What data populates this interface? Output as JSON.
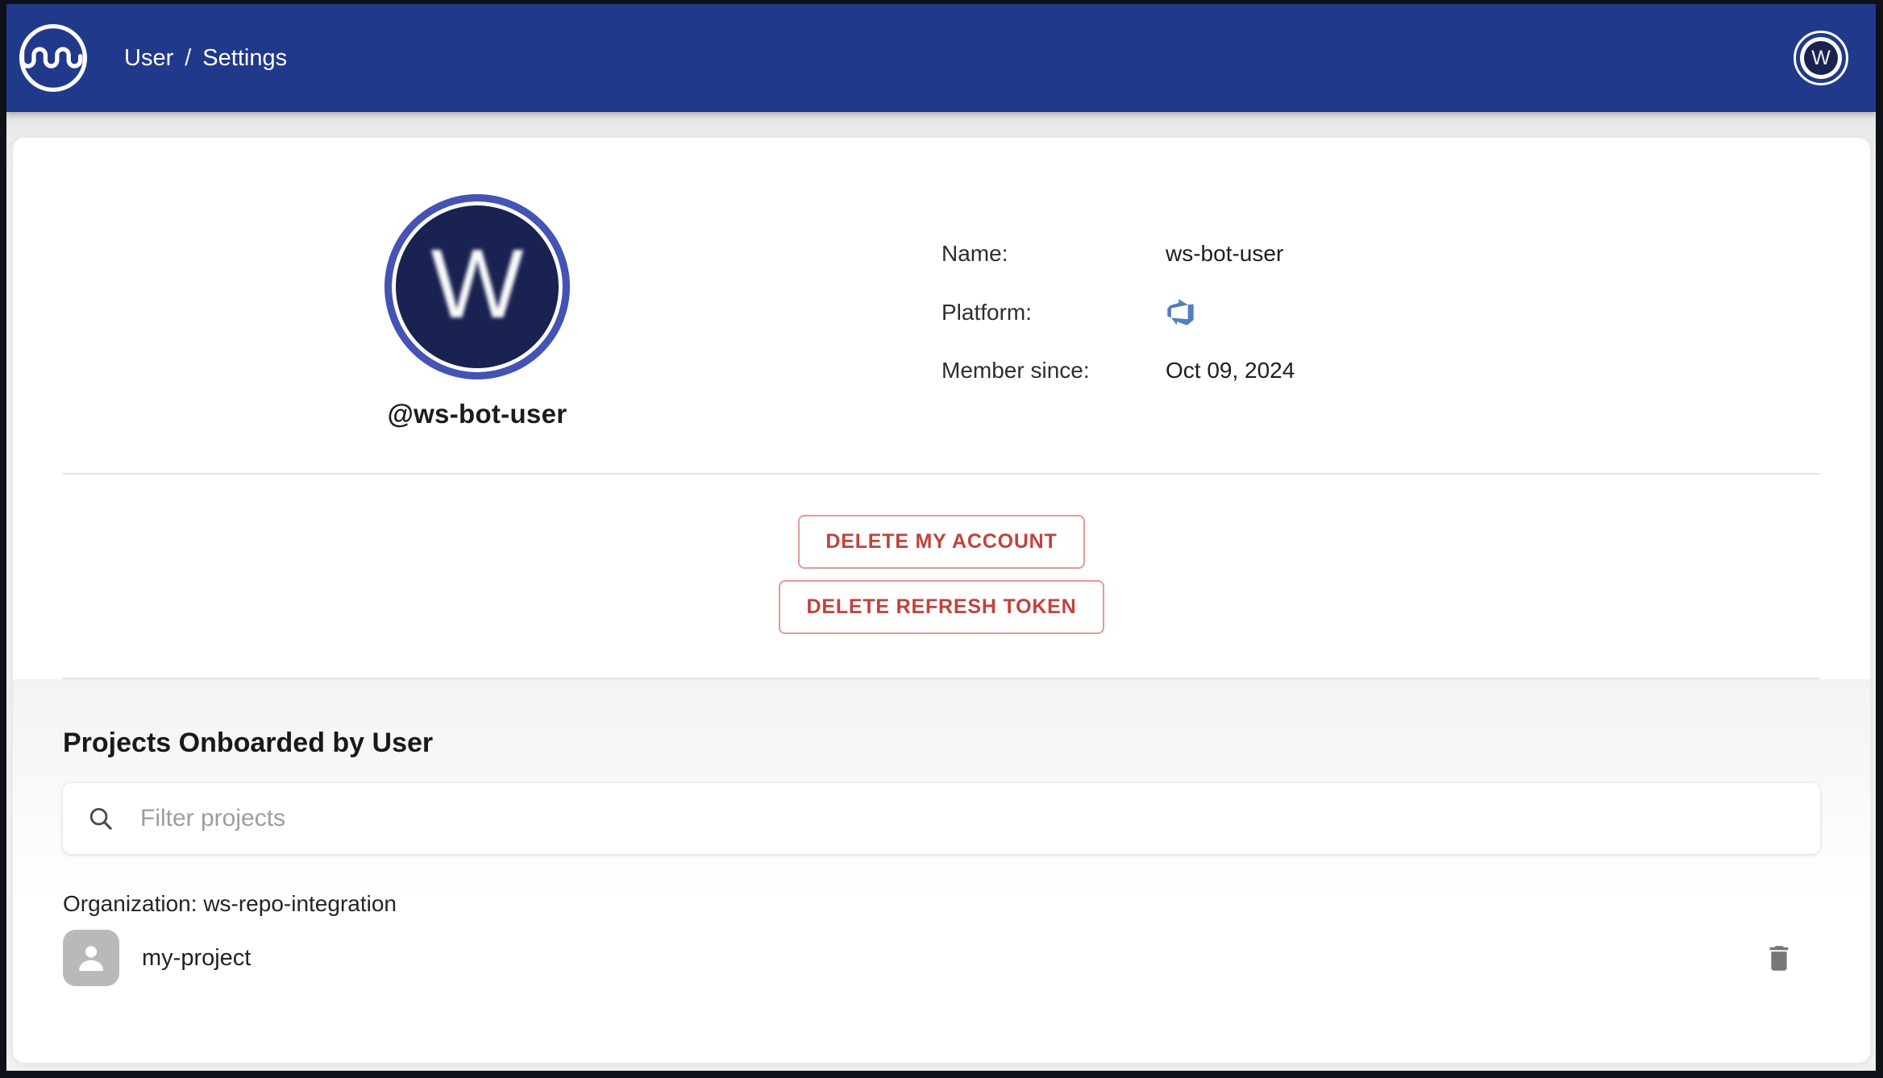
{
  "theme": {
    "header_bg": "#21398b",
    "frame_border": "#0f1219",
    "page_bg": "#f0f0f0",
    "card_bg": "#ffffff",
    "avatar_ring": "#4453b5",
    "avatar_disk": "#1a2251",
    "accent_red": "#c2423c",
    "accent_red_border": "#e39a94",
    "divider": "#e4e4e4",
    "project_avatar_bg": "#b9b9b9",
    "azure_blue": "#4e80bf",
    "icon_gray": "#777777"
  },
  "icons": {
    "logo": "wave-circle-logo",
    "header_avatar": "letter-avatar",
    "platform": "azure-devops",
    "search": "magnifying-glass",
    "project_avatar": "person",
    "project_delete": "trash-can"
  },
  "header": {
    "breadcrumb": [
      {
        "label": "User"
      },
      {
        "label": "Settings"
      }
    ],
    "separator": "/",
    "avatar_letter": "W"
  },
  "profile": {
    "avatar_letter": "W",
    "username": "@ws-bot-user",
    "fields": [
      {
        "label": "Name:",
        "value": "ws-bot-user"
      },
      {
        "label": "Platform:",
        "value": "",
        "value_icon": "azure-devops-icon"
      },
      {
        "label": "Member since:",
        "value": "Oct 09, 2024"
      }
    ]
  },
  "actions": {
    "delete_account": "DELETE MY ACCOUNT",
    "delete_token": "DELETE REFRESH TOKEN"
  },
  "projects": {
    "heading": "Projects Onboarded by User",
    "filter_placeholder": "Filter projects",
    "groups": [
      {
        "organization_label": "Organization: ws-repo-integration",
        "items": [
          {
            "name": "my-project"
          }
        ]
      }
    ]
  }
}
